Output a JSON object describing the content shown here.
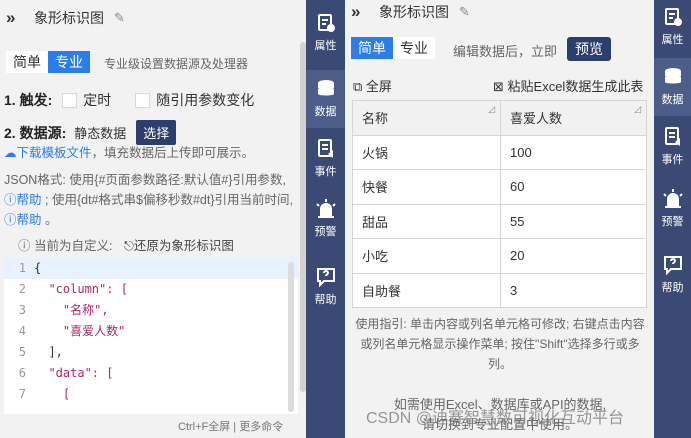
{
  "left": {
    "title": "象形标识图",
    "tabs": [
      "简单",
      "专业"
    ],
    "active_tab": "专业",
    "tab_hint": "专业级设置数据源及处理器",
    "trigger": {
      "label": "1. 触发:",
      "options": [
        "定时",
        "随引用参数变化"
      ]
    },
    "datasource": {
      "label": "2. 数据源:",
      "value": "静态数据",
      "select_button": "选择"
    },
    "download_line": {
      "link": "下载模板文件",
      "text": "，填充数据后上传即可展示。"
    },
    "json_help": {
      "p1": "JSON格式:  使用{#页面参数路径:默认值#}引用参数,",
      "help1": "帮助",
      "p2": " ; 使用{dt#格式串$偏移秒数#dt}引用当前时间,",
      "help2": "帮助",
      "p3": " 。"
    },
    "custom_line": {
      "info": "当前为自定义:",
      "restore": "还原为象形标识图"
    },
    "code_lines": [
      {
        "n": "1",
        "t": "{"
      },
      {
        "n": "2",
        "t": "  \"column\": ["
      },
      {
        "n": "3",
        "t": "    \"名称\","
      },
      {
        "n": "4",
        "t": "    \"喜爱人数\""
      },
      {
        "n": "5",
        "t": "  ],"
      },
      {
        "n": "6",
        "t": "  \"data\": ["
      },
      {
        "n": "7",
        "t": "    ["
      }
    ],
    "code_footer": "Ctrl+F全屏 | 更多命令"
  },
  "rail1": [
    {
      "label": "属性",
      "icon": "properties-icon"
    },
    {
      "label": "数据",
      "icon": "database-icon"
    },
    {
      "label": "事件",
      "icon": "event-icon"
    },
    {
      "label": "预警",
      "icon": "alarm-icon"
    },
    {
      "label": "帮助",
      "icon": "help-icon"
    }
  ],
  "right": {
    "title": "象形标识图",
    "tabs": [
      "简单",
      "专业"
    ],
    "active_tab": "简单",
    "tab_hint": "编辑数据后，立即",
    "preview_button": "预览",
    "fullscreen": "全屏",
    "paste_excel": "粘贴Excel数据生成此表",
    "table": {
      "headers": [
        "名称",
        "喜爱人数"
      ],
      "rows": [
        [
          "火锅",
          "100"
        ],
        [
          "快餐",
          "60"
        ],
        [
          "甜品",
          "55"
        ],
        [
          "小吃",
          "20"
        ],
        [
          "自助餐",
          "3"
        ]
      ]
    },
    "guide": "使用指引: 单击内容或列名单元格可修改; 右键点击内容或列名单元格显示操作菜单; 按住\"Shift\"选择多行或多列。",
    "bottom_line1": "如需使用Excel、数据库或API的数据,",
    "bottom_line2": "请切换到专业配置中使用。",
    "watermark": "CSDN @迪赛智慧数可视化互动平台"
  },
  "rail2": [
    {
      "label": "属性",
      "icon": "properties-icon"
    },
    {
      "label": "数据",
      "icon": "database-icon"
    },
    {
      "label": "事件",
      "icon": "event-icon"
    },
    {
      "label": "预警",
      "icon": "alarm-icon"
    },
    {
      "label": "帮助",
      "icon": "help-icon"
    }
  ],
  "colors": {
    "accent_blue": "#2b7de9",
    "navy_button": "#2c3e6b",
    "rail_bg": "#3b4a74",
    "rail_active": "#4d5d89"
  }
}
